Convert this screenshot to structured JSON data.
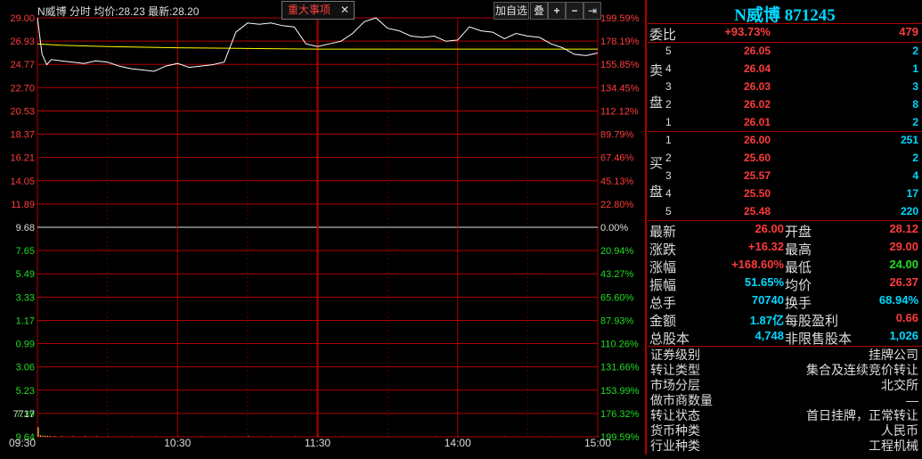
{
  "header": {
    "stock_name": "N威博",
    "mode": "分时",
    "avg_label": "均价:",
    "avg_value": "28.23",
    "latest_label": "最新:",
    "latest_value": "28.20",
    "events_tab": "重大事项",
    "events_close": "✕",
    "add_watch": "加自选",
    "overlay": "叠",
    "zoom_in": "+",
    "zoom_out": "−",
    "skip_end": "⇥"
  },
  "chart_data": {
    "type": "line",
    "title": "",
    "prev_close": 9.68,
    "price_ticks_left": [
      "29.00",
      "26.93",
      "24.77",
      "22.70",
      "20.53",
      "18.37",
      "16.21",
      "14.05",
      "11.89",
      "9.68",
      "7.65",
      "5.49",
      "3.33",
      "1.17",
      "0.99",
      "3.06",
      "5.23",
      "7.39",
      "9.64"
    ],
    "pct_ticks_right": [
      "199.59%",
      "178.19%",
      "155.85%",
      "134.45%",
      "112.12%",
      "89.79%",
      "67.46%",
      "45.13%",
      "22.80%",
      "0.00%",
      "20.94%",
      "43.27%",
      "65.60%",
      "87.93%",
      "110.26%",
      "131.66%",
      "153.99%",
      "176.32%",
      "199.59%"
    ],
    "volume_tick": "7717",
    "time_ticks": [
      "09:30",
      "10:30",
      "11:30",
      "14:00",
      "15:00"
    ],
    "ylim": [
      24.0,
      29.0
    ],
    "price_series": {
      "name": "",
      "times": [
        "09:30",
        "09:32",
        "09:34",
        "09:36",
        "09:40",
        "09:45",
        "09:50",
        "09:55",
        "10:00",
        "10:05",
        "10:10",
        "10:15",
        "10:20",
        "10:25",
        "10:30",
        "10:35",
        "10:40",
        "10:45",
        "10:50",
        "10:55",
        "11:00",
        "11:05",
        "11:10",
        "11:15",
        "11:20",
        "11:25",
        "11:30",
        "13:05",
        "13:10",
        "13:15",
        "13:20",
        "13:25",
        "13:30",
        "13:35",
        "13:40",
        "13:45",
        "13:50",
        "13:55",
        "14:00",
        "14:05",
        "14:10",
        "14:15",
        "14:20",
        "14:25",
        "14:30",
        "14:35",
        "14:40",
        "14:45",
        "14:50",
        "14:55",
        "15:00"
      ],
      "values": [
        29.0,
        26.2,
        25.4,
        25.8,
        25.7,
        25.6,
        25.5,
        25.7,
        25.6,
        25.3,
        25.1,
        25.0,
        24.9,
        25.3,
        25.5,
        25.2,
        25.3,
        25.4,
        25.6,
        27.9,
        28.6,
        28.5,
        28.6,
        28.4,
        28.3,
        27.0,
        26.8,
        27.0,
        27.2,
        27.8,
        28.7,
        29.0,
        28.2,
        28.0,
        27.6,
        27.5,
        27.6,
        27.2,
        27.3,
        28.3,
        28.0,
        27.9,
        27.4,
        27.8,
        27.6,
        27.5,
        27.0,
        26.7,
        26.2,
        26.1,
        26.3
      ]
    },
    "avg_series": {
      "name": "",
      "times": [
        "09:30",
        "09:40",
        "10:00",
        "10:30",
        "11:00",
        "11:30",
        "13:30",
        "14:00",
        "14:30",
        "15:00"
      ],
      "values": [
        27.0,
        26.9,
        26.8,
        26.7,
        26.65,
        26.6,
        26.6,
        26.6,
        26.6,
        26.6
      ]
    },
    "volume_series": {
      "times": [
        "09:30",
        "09:31",
        "09:32",
        "09:33",
        "09:34",
        "09:35",
        "09:37",
        "09:40",
        "09:45",
        "09:50",
        "09:55",
        "10:00",
        "10:10",
        "10:20",
        "10:30",
        "10:40",
        "10:50",
        "11:00",
        "11:10",
        "11:20",
        "11:30",
        "13:10",
        "13:30",
        "13:50",
        "14:00",
        "14:20",
        "14:40",
        "15:00"
      ],
      "values": [
        7717,
        1200,
        900,
        800,
        700,
        600,
        500,
        450,
        400,
        350,
        300,
        300,
        250,
        250,
        250,
        300,
        200,
        500,
        300,
        250,
        250,
        250,
        250,
        200,
        200,
        250,
        200,
        300
      ]
    }
  },
  "quote": {
    "title": "N威博 871245",
    "weibi_label": "委比",
    "weibi_pct": "+93.73%",
    "weibi_diff": "479",
    "sell_label_1": "卖",
    "sell_label_2": "盘",
    "buy_label_1": "买",
    "buy_label_2": "盘",
    "asks": [
      {
        "level": "5",
        "price": "26.05",
        "vol": "2"
      },
      {
        "level": "4",
        "price": "26.04",
        "vol": "1"
      },
      {
        "level": "3",
        "price": "26.03",
        "vol": "3"
      },
      {
        "level": "2",
        "price": "26.02",
        "vol": "8"
      },
      {
        "level": "1",
        "price": "26.01",
        "vol": "2"
      }
    ],
    "bids": [
      {
        "level": "1",
        "price": "26.00",
        "vol": "251"
      },
      {
        "level": "2",
        "price": "25.60",
        "vol": "2"
      },
      {
        "level": "3",
        "price": "25.57",
        "vol": "4"
      },
      {
        "level": "4",
        "price": "25.50",
        "vol": "17"
      },
      {
        "level": "5",
        "price": "25.48",
        "vol": "220"
      }
    ],
    "stats": [
      {
        "k1": "最新",
        "v1": "26.00",
        "k2": "开盘",
        "v2": "28.12"
      },
      {
        "k1": "涨跌",
        "v1": "+16.32",
        "k2": "最高",
        "v2": "29.00"
      },
      {
        "k1": "涨幅",
        "v1": "+168.60%",
        "k2": "最低",
        "v2": "24.00"
      },
      {
        "k1": "振幅",
        "v1": "51.65%",
        "k2": "均价",
        "v2": "26.37"
      },
      {
        "k1": "总手",
        "v1": "70740",
        "k2": "换手",
        "v2": "68.94%"
      },
      {
        "k1": "金额",
        "v1": "1.87亿",
        "k2": "每股盈利",
        "v2": "0.66"
      },
      {
        "k1": "总股本",
        "v1": "4,748",
        "k2": "非限售股本",
        "v2": "1,026"
      }
    ],
    "info": [
      {
        "k": "证券级别",
        "v": "挂牌公司"
      },
      {
        "k": "转让类型",
        "v": "集合及连续竞价转让"
      },
      {
        "k": "市场分层",
        "v": "北交所"
      },
      {
        "k": "做市商数量",
        "v": "—"
      },
      {
        "k": "转让状态",
        "v": "首日挂牌，正常转让"
      },
      {
        "k": "货币种类",
        "v": "人民币"
      },
      {
        "k": "行业种类",
        "v": "工程机械"
      }
    ],
    "colors": {
      "up": "#ff3b3b",
      "down": "#22dd22",
      "neutral": "#dddddd",
      "cyan": "#00d8ff",
      "grid": "#b00000",
      "yellow": "#ffff00"
    }
  }
}
